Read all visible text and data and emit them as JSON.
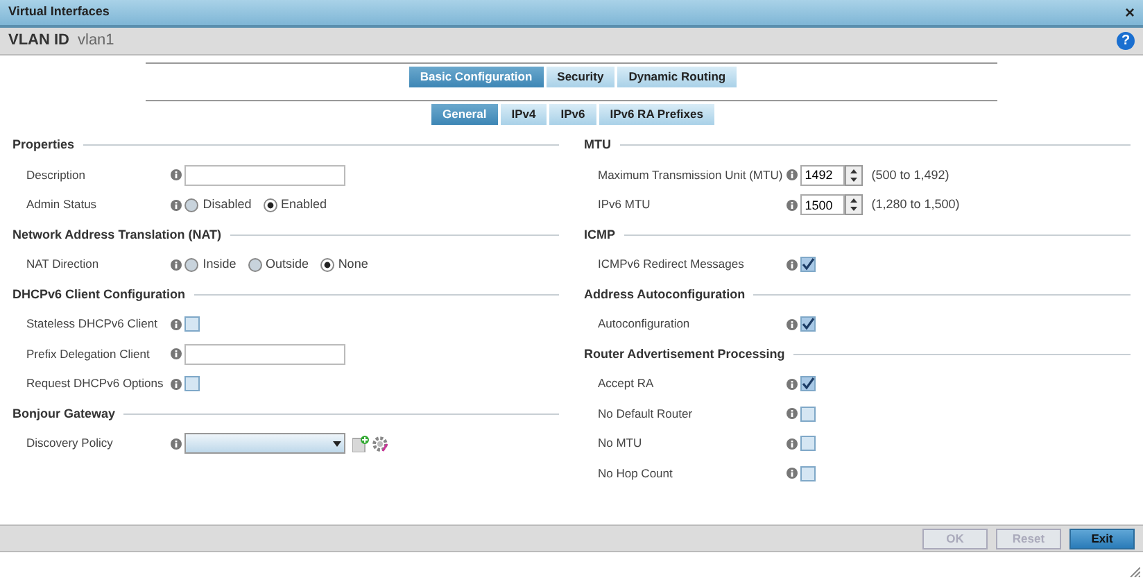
{
  "window": {
    "title": "Virtual Interfaces",
    "close": "×",
    "help": "?"
  },
  "header": {
    "label": "VLAN ID",
    "value": "vlan1"
  },
  "tabs": [
    {
      "label": "Basic Configuration",
      "selected": true
    },
    {
      "label": "Security",
      "selected": false
    },
    {
      "label": "Dynamic Routing",
      "selected": false
    }
  ],
  "subtabs": [
    {
      "label": "General",
      "selected": true
    },
    {
      "label": "IPv4",
      "selected": false
    },
    {
      "label": "IPv6",
      "selected": false
    },
    {
      "label": "IPv6 RA Prefixes",
      "selected": false
    }
  ],
  "left_sections": [
    {
      "title": "Properties",
      "fields": [
        {
          "kind": "text",
          "label": "Description"
        },
        {
          "kind": "radio",
          "label": "Admin Status",
          "options": [
            {
              "label": "Disabled",
              "selected": false
            },
            {
              "label": "Enabled",
              "selected": true
            }
          ]
        }
      ]
    },
    {
      "title": "Network Address Translation (NAT)",
      "fields": [
        {
          "kind": "radio",
          "label": "NAT Direction",
          "options": [
            {
              "label": "Inside",
              "selected": false
            },
            {
              "label": "Outside",
              "selected": false
            },
            {
              "label": "None",
              "selected": true
            }
          ]
        }
      ]
    },
    {
      "title": "DHCPv6 Client Configuration",
      "fields": [
        {
          "kind": "checkbox",
          "label": "Stateless DHCPv6 Client",
          "checked": false
        },
        {
          "kind": "text",
          "label": "Prefix Delegation Client"
        },
        {
          "kind": "checkbox",
          "label": "Request DHCPv6 Options",
          "checked": false
        }
      ]
    },
    {
      "title": "Bonjour Gateway",
      "fields": [
        {
          "kind": "select",
          "label": "Discovery Policy"
        }
      ]
    }
  ],
  "right_sections": [
    {
      "title": "MTU",
      "fields": [
        {
          "kind": "spinner",
          "label": "Maximum Transmission Unit (MTU)",
          "value": "1492",
          "range": "(500 to 1,492)"
        },
        {
          "kind": "spinner",
          "label": "IPv6 MTU",
          "value": "1500",
          "range": "(1,280 to 1,500)"
        }
      ]
    },
    {
      "title": "ICMP",
      "fields": [
        {
          "kind": "checkbox",
          "label": "ICMPv6 Redirect Messages",
          "checked": true
        }
      ]
    },
    {
      "title": "Address Autoconfiguration",
      "fields": [
        {
          "kind": "checkbox",
          "label": "Autoconfiguration",
          "checked": true
        }
      ]
    },
    {
      "title": "Router Advertisement Processing",
      "fields": [
        {
          "kind": "checkbox",
          "label": "Accept RA",
          "checked": true
        },
        {
          "kind": "checkbox",
          "label": "No Default Router",
          "checked": false
        },
        {
          "kind": "checkbox",
          "label": "No MTU",
          "checked": false
        },
        {
          "kind": "checkbox",
          "label": "No Hop Count",
          "checked": false
        }
      ]
    }
  ],
  "buttons": [
    {
      "label": "OK",
      "disabled": true
    },
    {
      "label": "Reset",
      "disabled": true
    },
    {
      "label": "Exit",
      "disabled": false
    }
  ]
}
